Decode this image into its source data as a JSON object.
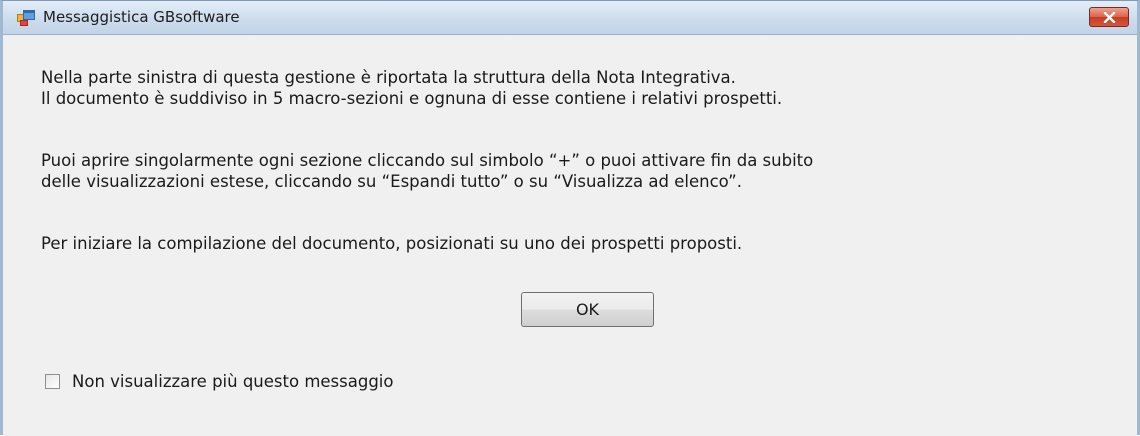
{
  "window": {
    "title": "Messaggistica GBsoftware",
    "icon": "app-window-icon",
    "close_icon": "close-icon"
  },
  "message": {
    "paragraph1": [
      "Nella parte sinistra di questa gestione è riportata la struttura della Nota Integrativa.",
      "Il documento è suddiviso in 5 macro-sezioni e ognuna di esse contiene i relativi prospetti."
    ],
    "paragraph2": [
      "Puoi aprire singolarmente ogni sezione cliccando sul simbolo “+” o puoi attivare fin da subito",
      "delle visualizzazioni estese, cliccando su “Espandi tutto” o su “Visualizza ad elenco”."
    ],
    "paragraph3": "Per iniziare la compilazione del documento, posizionati su uno dei prospetti proposti."
  },
  "buttons": {
    "ok_label": "OK"
  },
  "checkbox": {
    "label": "Non visualizzare più questo messaggio",
    "checked": false
  },
  "colors": {
    "dialog_background": "#f0f0f0",
    "titlebar_background": "#cddceb",
    "close_button": "#c63d22"
  }
}
